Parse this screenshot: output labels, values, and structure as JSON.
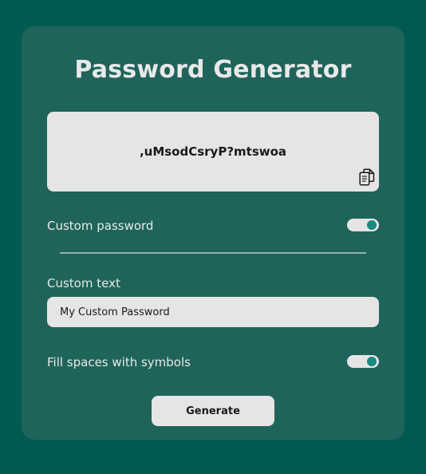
{
  "title": "Password Generator",
  "output": {
    "password": ",uMsodCsryP?mtswoa",
    "copy_icon": "copy-icon"
  },
  "custom_password": {
    "label": "Custom password",
    "enabled": true
  },
  "custom_text": {
    "label": "Custom text",
    "value": "My Custom Password"
  },
  "fill_symbols": {
    "label": "Fill spaces with symbols",
    "enabled": true
  },
  "generate_label": "Generate",
  "colors": {
    "page_background": "#005a4f",
    "card_background": "#1f645b",
    "toggle_accent": "#1a8a80"
  }
}
